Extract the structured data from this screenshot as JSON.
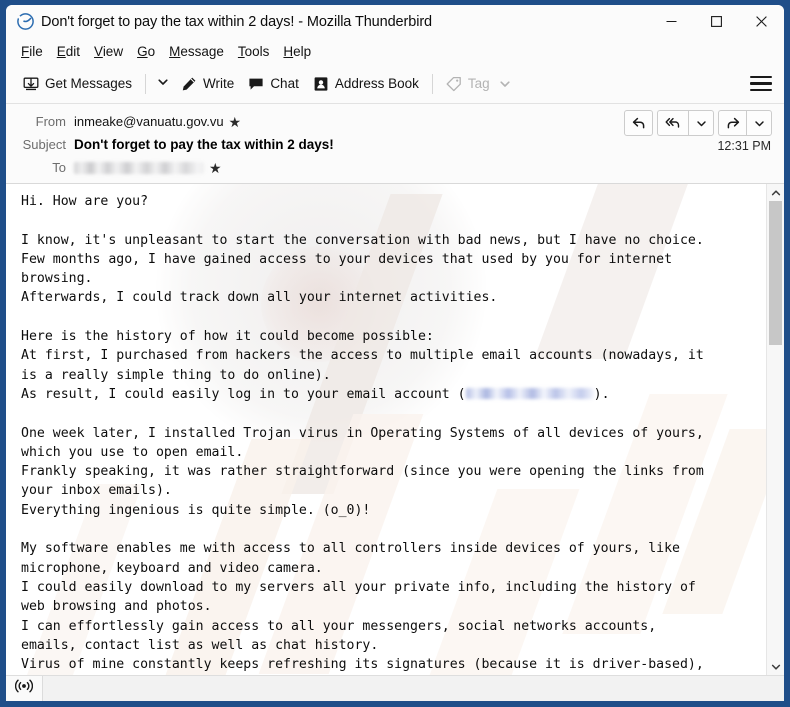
{
  "window": {
    "title": "Don't forget to pay the tax within 2 days! - Mozilla Thunderbird",
    "app_icon": "thunderbird-icon",
    "controls": {
      "minimize": "minimize-icon",
      "maximize": "maximize-icon",
      "close": "close-icon"
    },
    "accent_border_color": "#1f4e89"
  },
  "menubar": {
    "items": [
      {
        "label": "File",
        "mnemonic": "F"
      },
      {
        "label": "Edit",
        "mnemonic": "E"
      },
      {
        "label": "View",
        "mnemonic": "V"
      },
      {
        "label": "Go",
        "mnemonic": "G"
      },
      {
        "label": "Message",
        "mnemonic": "M"
      },
      {
        "label": "Tools",
        "mnemonic": "T"
      },
      {
        "label": "Help",
        "mnemonic": "H"
      }
    ]
  },
  "toolbar": {
    "get_messages_label": "Get Messages",
    "write_label": "Write",
    "chat_label": "Chat",
    "address_book_label": "Address Book",
    "tag_label": "Tag",
    "tag_disabled": true,
    "app_menu_icon": "hamburger-menu-icon"
  },
  "message_header": {
    "from_label": "From",
    "from_value": "inmeake@vanuatu.gov.vu",
    "subject_label": "Subject",
    "subject_value": "Don't forget to pay the tax within 2 days!",
    "to_label": "To",
    "to_value_redacted": true,
    "timestamp": "12:31 PM",
    "actions": [
      {
        "name": "reply-button",
        "icon": "reply-icon"
      },
      {
        "name": "reply-all-button",
        "icon": "reply-all-icon"
      },
      {
        "name": "reply-menu-button",
        "icon": "chevron-down-icon"
      },
      {
        "name": "forward-button",
        "icon": "forward-icon"
      },
      {
        "name": "more-actions-button",
        "icon": "chevron-down-icon"
      }
    ]
  },
  "body": {
    "paragraphs": [
      "Hi. How are you?",
      "",
      "I know, it's unpleasant to start the conversation with bad news, but I have no choice.\nFew months ago, I have gained access to your devices that used by you for internet\nbrowsing.\nAfterwards, I could track down all your internet activities.",
      "",
      "Here is the history of how it could become possible:\nAt first, I purchased from hackers the access to multiple email accounts (nowadays, it\nis a really simple thing to do online).",
      "As result, I could easily log in to your email account (",
      ").",
      "",
      "One week later, I installed Trojan virus in Operating Systems of all devices of yours,\nwhich you use to open email.\nFrankly speaking, it was rather straightforward (since you were opening the links from\nyour inbox emails).\nEverything ingenious is quite simple. (o_0)!",
      "",
      "My software enables me with access to all controllers inside devices of yours, like\nmicrophone, keyboard and video camera.\nI could easily download to my servers all your private info, including the history of\nweb browsing and photos.\nI can effortlessly gain access to all your messengers, social networks accounts,\nemails, contact list as well as chat history.\nVirus of mine constantly keeps refreshing its signatures (because it is driver-based),\nand as result remains unnoticed by your antivirus."
    ],
    "redacted_email_link": true,
    "scroll_position_percent": 0
  },
  "statusbar": {
    "icon": "broadcast-icon"
  }
}
